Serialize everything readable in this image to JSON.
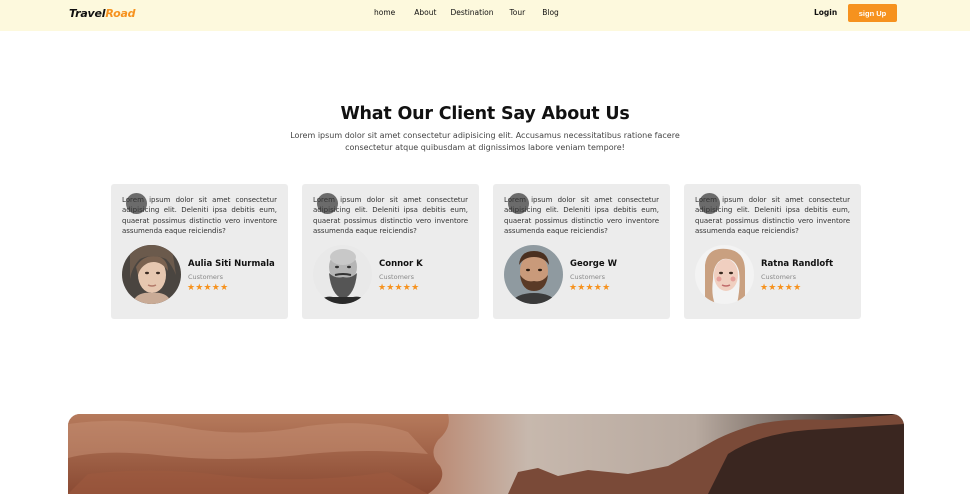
{
  "nav": {
    "logo_part1": "Travel",
    "logo_part2": "Road",
    "links": [
      "home",
      "About",
      "Destination",
      "Tour",
      "Blog"
    ],
    "login": "Login",
    "signup": "sign Up"
  },
  "testimonials": {
    "title": "What Our Client Say About Us",
    "description": "Lorem ipsum dolor sit amet consectetur adipisicing elit. Accusamus necessitatibus ratione facere consectetur atque quibusdam at dignissimos labore veniam tempore!",
    "cards": [
      {
        "text": "Lorem ipsum dolor sit amet consectetur adipisicing elit. Deleniti ipsa debitis eum, quaerat possimus distinctio vero inventore assumenda eaque reiciendis?",
        "name": "Aulia Siti Nurmala",
        "role": "Customers",
        "stars": "★★★★★",
        "rating": 5
      },
      {
        "text": "Lorem ipsum dolor sit amet consectetur adipisicing elit. Deleniti ipsa debitis eum, quaerat possimus distinctio vero inventore assumenda eaque reiciendis?",
        "name": "Connor K",
        "role": "Customers",
        "stars": "★★★★★",
        "rating": 5
      },
      {
        "text": "Lorem ipsum dolor sit amet consectetur adipisicing elit. Deleniti ipsa debitis eum, quaerat possimus distinctio vero inventore assumenda eaque reiciendis?",
        "name": "George W",
        "role": "Customers",
        "stars": "★★★★★",
        "rating": 5
      },
      {
        "text": "Lorem ipsum dolor sit amet consectetur adipisicing elit. Deleniti ipsa debitis eum, quaerat possimus distinctio vero inventore assumenda eaque reiciendis?",
        "name": "Ratna Randloft",
        "role": "Customers",
        "stars": "★★★★★",
        "rating": 5
      }
    ]
  },
  "colors": {
    "accent": "#f6921e",
    "nav_bg": "#fdf9dd",
    "card_bg": "#ececec"
  }
}
